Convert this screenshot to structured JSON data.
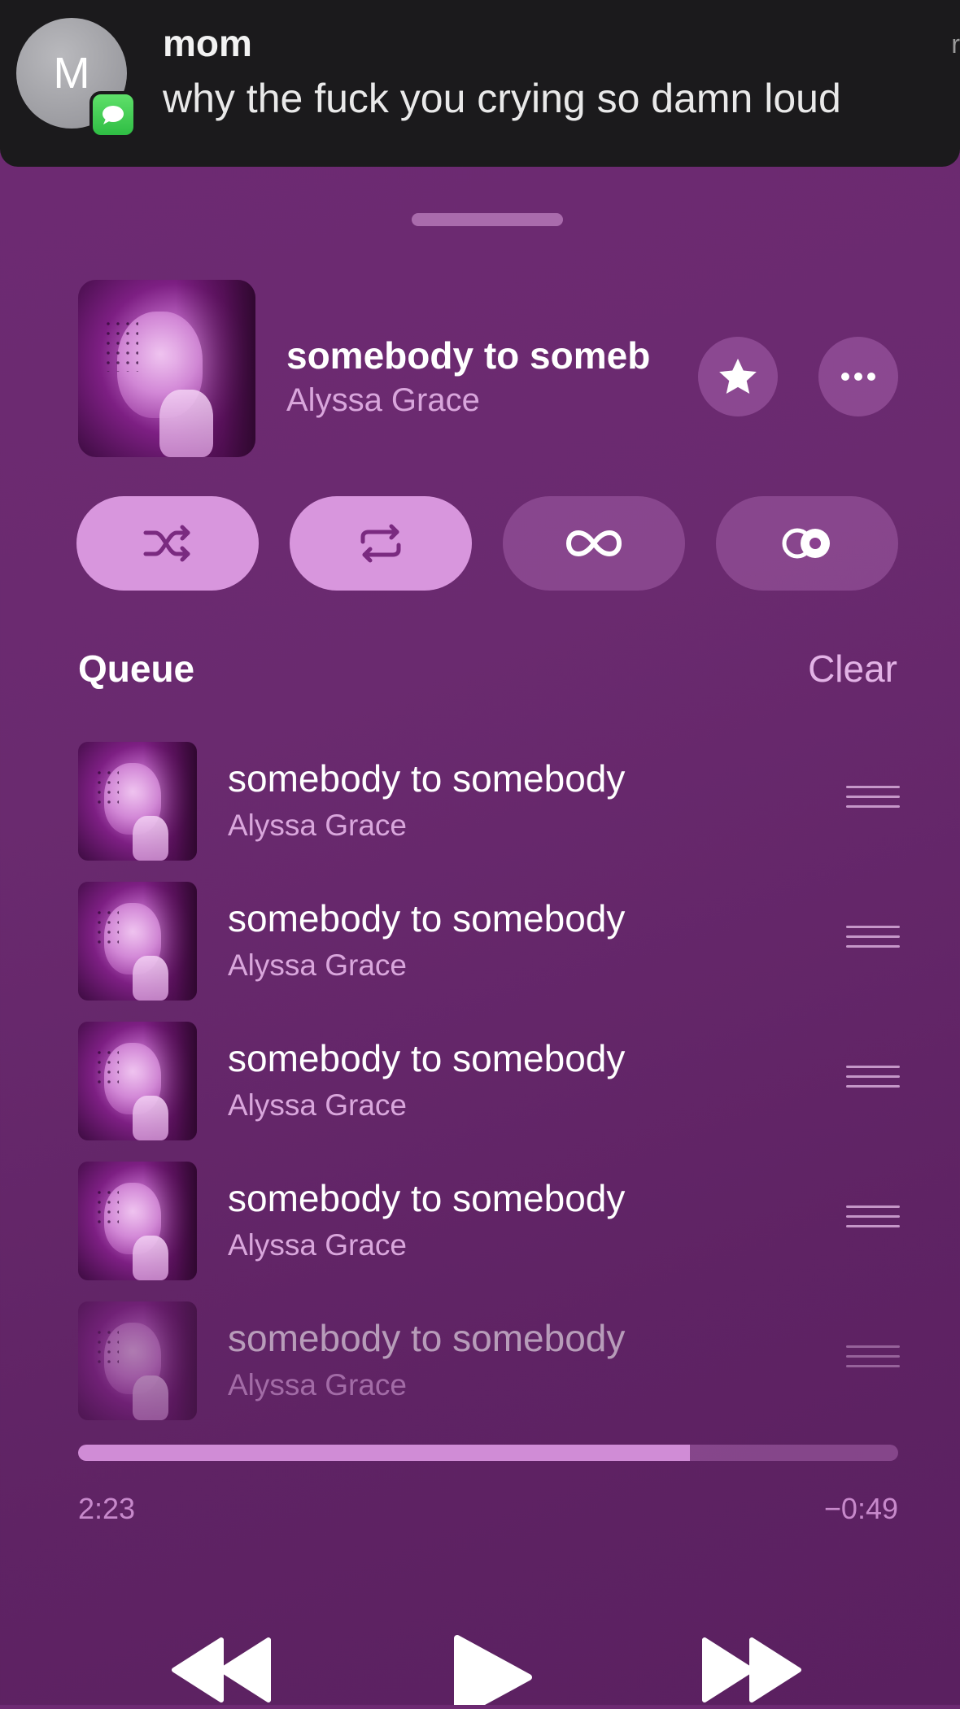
{
  "notification": {
    "avatar_initial": "M",
    "sender": "mom",
    "message": "why the fuck you crying so damn loud",
    "edge_char": "r"
  },
  "now_playing": {
    "title": "somebody to someb",
    "artist": "Alyssa Grace",
    "favorite_icon": "star-icon",
    "more_icon": "ellipsis-icon"
  },
  "modes": [
    {
      "name": "shuffle",
      "icon": "shuffle-icon",
      "active": true
    },
    {
      "name": "repeat",
      "icon": "repeat-icon",
      "active": true
    },
    {
      "name": "infinity",
      "icon": "infinity-icon",
      "active": false
    },
    {
      "name": "autoplay",
      "icon": "autoplay-icon",
      "active": false
    }
  ],
  "queue": {
    "label": "Queue",
    "clear_label": "Clear",
    "items": [
      {
        "title": "somebody to somebody",
        "artist": "Alyssa Grace"
      },
      {
        "title": "somebody to somebody",
        "artist": "Alyssa Grace"
      },
      {
        "title": "somebody to somebody",
        "artist": "Alyssa Grace"
      },
      {
        "title": "somebody to somebody",
        "artist": "Alyssa Grace"
      },
      {
        "title": "somebody to somebody",
        "artist": "Alyssa Grace"
      }
    ]
  },
  "playback": {
    "elapsed": "2:23",
    "remaining": "−0:49",
    "progress_fraction": 0.746
  },
  "colors": {
    "background": "#6a2a6f",
    "accent": "#d896dd",
    "secondary_text": "#d9a6dc"
  }
}
